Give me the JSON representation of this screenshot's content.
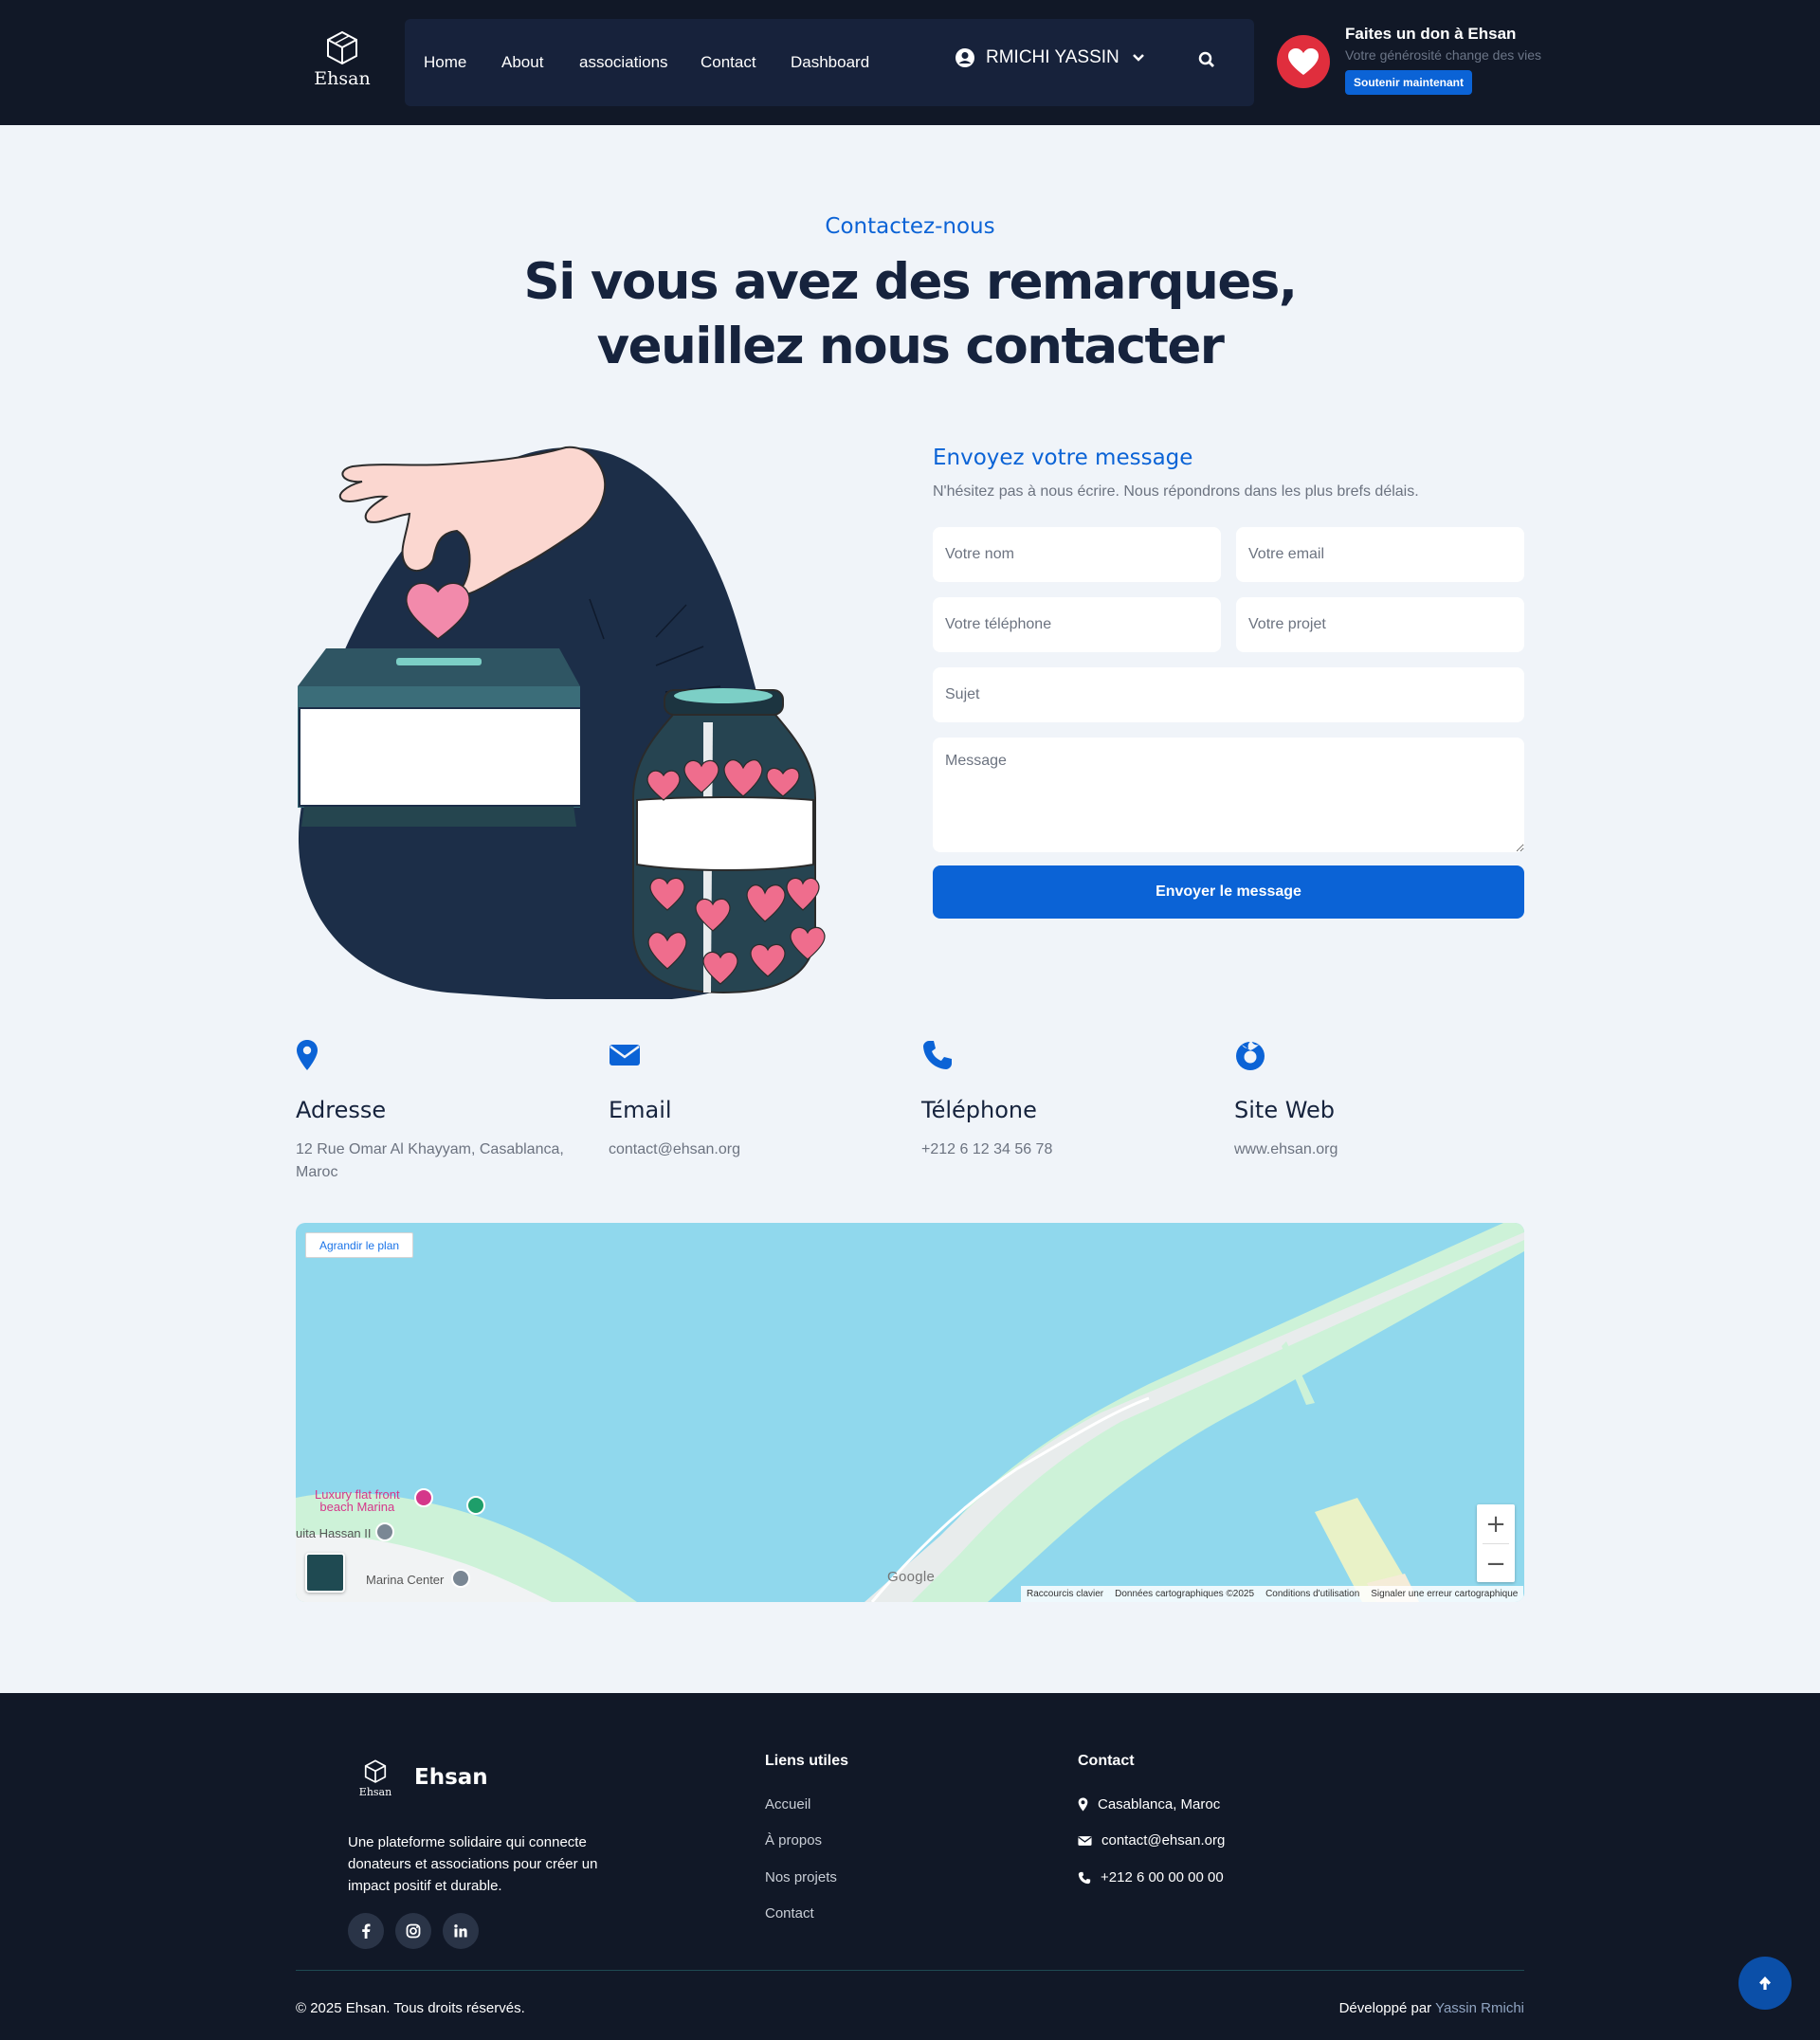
{
  "header": {
    "logo_text": "Ehsan",
    "nav": [
      "Home",
      "About",
      "associations",
      "Contact",
      "Dashboard"
    ],
    "user_name": "RMICHI YASSIN",
    "donate": {
      "title": "Faites un don à Ehsan",
      "subtitle": "Votre générosité change des vies",
      "button": "Soutenir maintenant"
    }
  },
  "hero": {
    "eyebrow": "Contactez-nous",
    "headline_line1": "Si vous avez des remarques,",
    "headline_line2": "veuillez nous contacter"
  },
  "form": {
    "title": "Envoyez votre message",
    "subtitle": "N'hésitez pas à nous écrire. Nous répondrons dans les plus brefs délais.",
    "name_placeholder": "Votre nom",
    "email_placeholder": "Votre email",
    "phone_placeholder": "Votre téléphone",
    "project_placeholder": "Votre projet",
    "subject_placeholder": "Sujet",
    "message_placeholder": "Message",
    "submit": "Envoyer le message"
  },
  "info": [
    {
      "icon": "map-pin-icon",
      "title": "Adresse",
      "text": "12 Rue Omar Al Khayyam, Casablanca, Maroc"
    },
    {
      "icon": "envelope-icon",
      "title": "Email",
      "text": "contact@ehsan.org"
    },
    {
      "icon": "phone-icon",
      "title": "Téléphone",
      "text": "+212 6 12 34 56 78"
    },
    {
      "icon": "firefox-icon",
      "title": "Site Web",
      "text": "www.ehsan.org"
    }
  ],
  "map": {
    "expand": "Agrandir le plan",
    "labels": [
      "Luxury flat front",
      "beach Marina",
      "Marina Center",
      "uita Hassan II"
    ],
    "google": "Google",
    "attribution": [
      "Raccourcis clavier",
      "Données cartographiques ©2025",
      "Conditions d'utilisation",
      "Signaler une erreur cartographique"
    ]
  },
  "footer": {
    "brand": "Ehsan",
    "logo_small": "Ehsan",
    "description": "Une plateforme solidaire qui connecte donateurs et associations pour créer un impact positif et durable.",
    "links_title": "Liens utiles",
    "links": [
      "Accueil",
      "À propos",
      "Nos projets",
      "Contact"
    ],
    "contact_title": "Contact",
    "contact": {
      "address": "Casablanca, Maroc",
      "email": "contact@ehsan.org",
      "phone": "+212 6 00 00 00 00"
    },
    "copyright": "© 2025 Ehsan. Tous droits réservés.",
    "credit_prefix": "Développé par",
    "credit_name": "Yassin Rmichi"
  },
  "colors": {
    "primary": "#0b63d6",
    "header_bg": "#111827",
    "heart": "#e02e3d"
  }
}
